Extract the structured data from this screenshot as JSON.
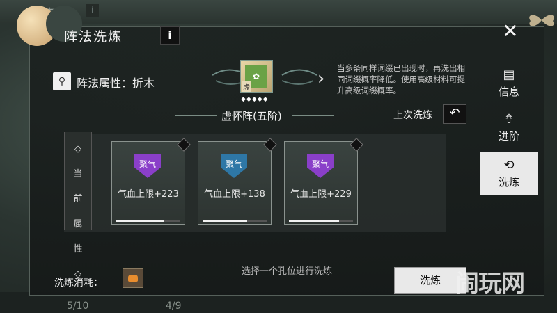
{
  "background": {
    "title": "阵法",
    "info_icon": "i",
    "bottom_left_count": "5/10",
    "bottom_mid_count": "4/9"
  },
  "dialog": {
    "title": "阵法洗炼",
    "info_icon": "i",
    "close_icon": "✕"
  },
  "formation": {
    "attr_label": "阵法属性：折木",
    "gem_char": "虚",
    "stars": "◆◆◆◆◆",
    "name": "虚怀阵(五阶)",
    "description": "当多条同样词缀已出现时，再洗出相同词缀概率降低。使用高级材料可提升高级词缀概率。",
    "last_refine_label": "上次洗炼",
    "last_refine_icon": "↶"
  },
  "current_attrs_label": "◇当前属性◇",
  "current_attrs_chars": [
    "◇",
    "当",
    "前",
    "属",
    "性",
    "◇"
  ],
  "slots": [
    {
      "badge": "聚气",
      "color": "#8a3fc9",
      "value": "气血上限+223",
      "progress": 0.75
    },
    {
      "badge": "聚气",
      "color": "#2e77a6",
      "value": "气血上限+138",
      "progress": 0.7
    },
    {
      "badge": "聚气",
      "color": "#8a3fc9",
      "value": "气血上限+229",
      "progress": 0.78
    }
  ],
  "hint": "选择一个孔位进行洗炼",
  "cost": {
    "label": "洗炼消耗：",
    "item_icon": "material-icon"
  },
  "refine_button": "洗炼",
  "side_tabs": [
    {
      "icon": "scroll-icon",
      "glyph": "▤",
      "label": "信息",
      "active": false
    },
    {
      "icon": "upgrade-icon",
      "glyph": "⇮",
      "label": "进阶",
      "active": false
    },
    {
      "icon": "refine-icon",
      "glyph": "⟲",
      "label": "洗炼",
      "active": true
    }
  ],
  "watermark": "闹玩网"
}
